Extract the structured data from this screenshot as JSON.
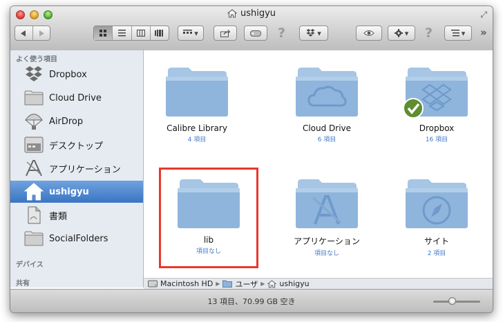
{
  "window": {
    "title": "ushigyu"
  },
  "sidebar": {
    "favorites_header": "よく使う項目",
    "items": [
      {
        "label": "Dropbox",
        "icon": "dropbox-icon"
      },
      {
        "label": "Cloud Drive",
        "icon": "folder-icon"
      },
      {
        "label": "AirDrop",
        "icon": "airdrop-icon"
      },
      {
        "label": "デスクトップ",
        "icon": "desktop-icon"
      },
      {
        "label": "アプリケーション",
        "icon": "applications-icon"
      },
      {
        "label": "ushigyu",
        "icon": "home-icon",
        "selected": true
      },
      {
        "label": "書類",
        "icon": "documents-icon"
      },
      {
        "label": "SocialFolders",
        "icon": "folder-icon"
      }
    ],
    "devices_header": "デバイス",
    "shared_header": "共有"
  },
  "files": [
    {
      "name": "Calibre Library",
      "count": "4 項目",
      "icon": "folder-icon"
    },
    {
      "name": "Cloud Drive",
      "count": "6 項目",
      "icon": "cloud-folder-icon"
    },
    {
      "name": "Dropbox",
      "count": "16 項目",
      "icon": "dropbox-folder-icon"
    },
    {
      "name": "lib",
      "count": "項目なし",
      "icon": "folder-icon",
      "highlighted": true
    },
    {
      "name": "アプリケーション",
      "count": "項目なし",
      "icon": "applications-folder-icon"
    },
    {
      "name": "サイト",
      "count": "2 項目",
      "icon": "sites-folder-icon"
    }
  ],
  "pathbar": {
    "segments": [
      "Macintosh HD",
      "ユーザ",
      "ushigyu"
    ]
  },
  "status": {
    "text": "13 項目、70.99 GB 空き"
  },
  "colors": {
    "selection": "#3a75c4",
    "count_text": "#3e78c8",
    "highlight_box": "#e8372b",
    "folder": "#8fb5dc"
  },
  "icon_size_slider": 0.4
}
